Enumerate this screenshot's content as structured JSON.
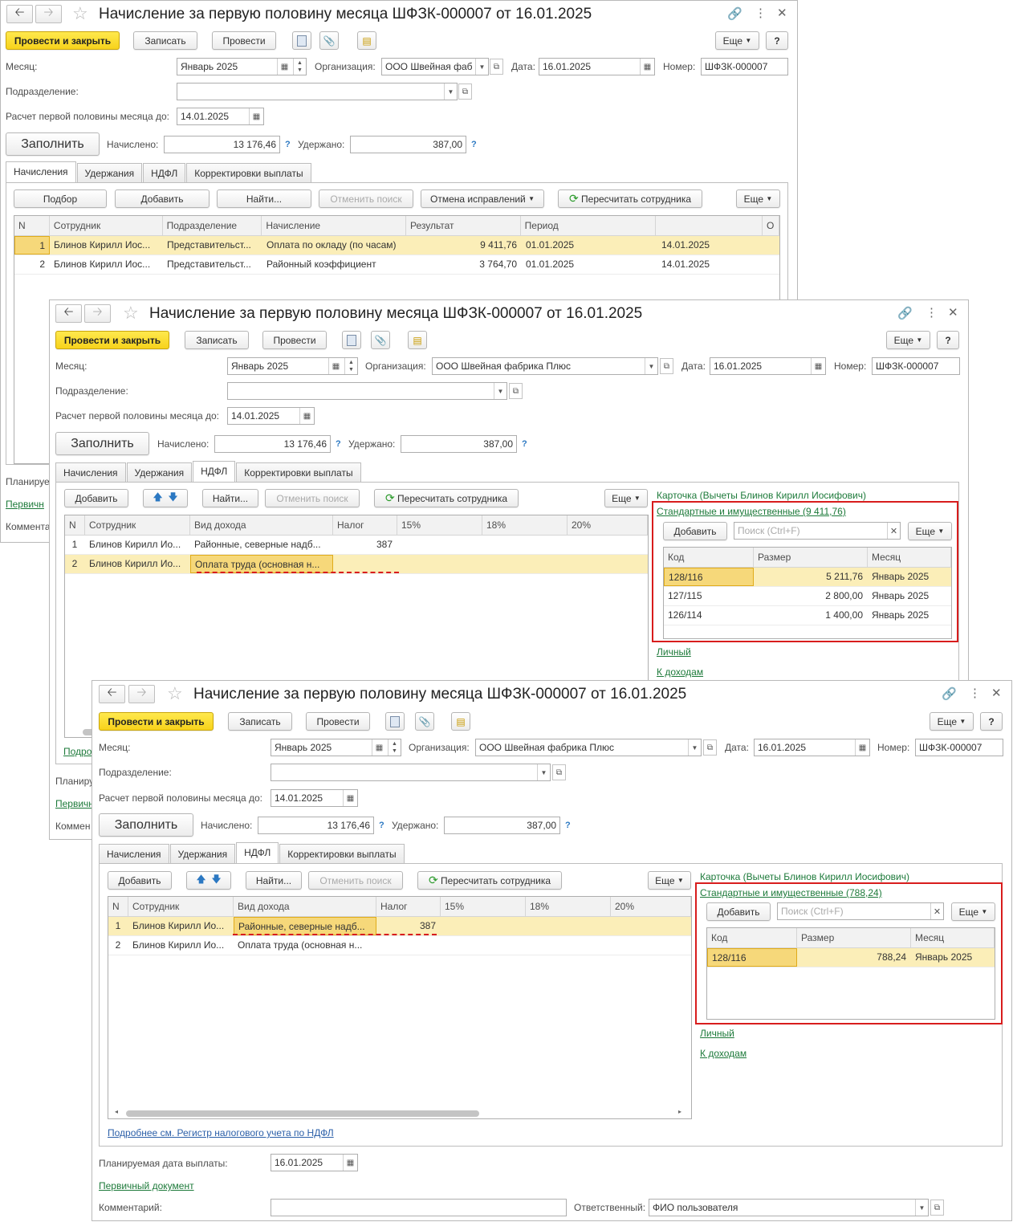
{
  "doc_title": "Начисление за первую половину месяца ШФЗК-000007 от 16.01.2025",
  "buttons": {
    "post_close": "Провести и закрыть",
    "save": "Записать",
    "post": "Провести",
    "more": "Еще",
    "help": "?",
    "fill": "Заполнить"
  },
  "labels": {
    "month": "Месяц:",
    "org": "Организация:",
    "date": "Дата:",
    "number": "Номер:",
    "dept": "Подразделение:",
    "calc_until": "Расчет первой половины месяца до:",
    "accrued": "Начислено:",
    "withheld": "Удержано:",
    "q": "?"
  },
  "values": {
    "month": "Январь 2025",
    "org_short": "ООО Швейная фаб",
    "org": "ООО Швейная фабрика Плюс",
    "date": "16.01.2025",
    "number": "ШФЗК-000007",
    "dept": "",
    "calc_until": "14.01.2025",
    "accrued": "13 176,46",
    "withheld": "387,00"
  },
  "tabs": [
    "Начисления",
    "Удержания",
    "НДФЛ",
    "Корректировки выплаты"
  ],
  "w1": {
    "toolbar": [
      "Подбор",
      "Добавить",
      "Найти...",
      "Отменить поиск",
      "Отмена исправлений",
      "Пересчитать сотрудника",
      "Еще"
    ],
    "columns": [
      "N",
      "Сотрудник",
      "Подразделение",
      "Начисление",
      "Результат",
      "Период",
      "",
      "О"
    ],
    "rows": [
      [
        "1",
        "Блинов Кирилл Иос...",
        "Представительст...",
        "Оплата по окладу (по часам)",
        "9 411,76",
        "01.01.2025",
        "14.01.2025"
      ],
      [
        "2",
        "Блинов Кирилл Иос...",
        "Представительст...",
        "Районный коэффициент",
        "3 764,70",
        "01.01.2025",
        "14.01.2025"
      ]
    ],
    "footer": [
      "Планируе",
      "Первичн",
      "Коммента"
    ]
  },
  "ndfl": {
    "toolbar": [
      "Добавить",
      "Найти...",
      "Отменить поиск",
      "Пересчитать сотрудника",
      "Еще"
    ],
    "columns": [
      "N",
      "Сотрудник",
      "Вид дохода",
      "Налог",
      "15%",
      "18%",
      "20%"
    ],
    "card_link": "Карточка (Вычеты Блинов Кирилл Иосифович)",
    "sub_add": "Добавить",
    "search_ph": "Поиск (Ctrl+F)",
    "sub_cols": [
      "Код",
      "Размер",
      "Месяц"
    ],
    "personal": "Личный",
    "to_income": "К доходам"
  },
  "w2": {
    "rows": [
      [
        "1",
        "Блинов Кирилл Ио...",
        "Районные, северные надб...",
        "387"
      ],
      [
        "2",
        "Блинов Кирилл Ио...",
        "Оплата труда (основная н...",
        ""
      ]
    ],
    "std_link": "Стандартные и имущественные (9 411,76)",
    "deductions": [
      [
        "128/116",
        "5 211,76",
        "Январь 2025"
      ],
      [
        "127/115",
        "2 800,00",
        "Январь 2025"
      ],
      [
        "126/114",
        "1 400,00",
        "Январь 2025"
      ]
    ],
    "footer": [
      "Подро",
      "Планиру",
      "Первичн",
      "Коммен"
    ]
  },
  "w3": {
    "rows": [
      [
        "1",
        "Блинов Кирилл Ио...",
        "Районные, северные надб...",
        "387"
      ],
      [
        "2",
        "Блинов Кирилл Ио...",
        "Оплата труда (основная н...",
        ""
      ]
    ],
    "std_link": "Стандартные и имущественные (788,24)",
    "deductions": [
      [
        "128/116",
        "788,24",
        "Январь 2025"
      ]
    ],
    "details_link": "Подробнее см. Регистр налогового учета по НДФЛ",
    "pay_date_label": "Планируемая дата выплаты:",
    "pay_date": "16.01.2025",
    "primary_doc": "Первичный документ",
    "comment_label": "Комментарий:",
    "responsible_label": "Ответственный:",
    "responsible": "ФИО пользователя"
  }
}
